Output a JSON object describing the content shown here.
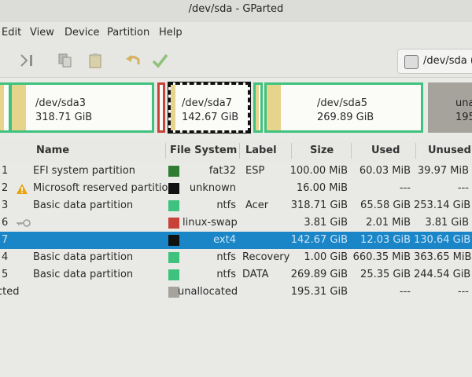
{
  "window": {
    "title": "/dev/sda - GParted"
  },
  "menu": [
    "Edit",
    "View",
    "Device",
    "Partition",
    "Help"
  ],
  "toolbar": {
    "icons": [
      "apply-icon",
      "copy-icon",
      "paste-icon",
      "undo-icon",
      "check-icon"
    ],
    "device": "/dev/sda ("
  },
  "map": {
    "blocks": [
      {
        "name": "/dev/sda3",
        "size": "318.71 GiB"
      },
      {
        "name": "/dev/sda7",
        "size": "142.67 GiB"
      },
      {
        "name": "/dev/sda5",
        "size": "269.89 GiB"
      },
      {
        "name": "una",
        "size": "195"
      }
    ]
  },
  "table": {
    "headers": [
      "Name",
      "File System",
      "Label",
      "Size",
      "Used",
      "Unused"
    ],
    "rows": [
      {
        "num": "1",
        "name": "EFI system partition",
        "fs": "fat32",
        "fs_color": "#2e7d32",
        "label": "ESP",
        "size": "100.00 MiB",
        "used": "60.03 MiB",
        "unused": "39.97 MiB",
        "warn": false,
        "key": false
      },
      {
        "num": "2",
        "name": "Microsoft reserved partition",
        "fs": "unknown",
        "fs_color": "#111111",
        "label": "",
        "size": "16.00 MiB",
        "used": "---",
        "unused": "---",
        "warn": true,
        "key": false
      },
      {
        "num": "3",
        "name": "Basic data partition",
        "fs": "ntfs",
        "fs_color": "#3fc27e",
        "label": "Acer",
        "size": "318.71 GiB",
        "used": "65.58 GiB",
        "unused": "253.14 GiB",
        "warn": false,
        "key": false
      },
      {
        "num": "6",
        "name": "",
        "fs": "linux-swap",
        "fs_color": "#c8423a",
        "label": "",
        "size": "3.81 GiB",
        "used": "2.01 MiB",
        "unused": "3.81 GiB",
        "warn": false,
        "key": true
      },
      {
        "num": "7",
        "name": "",
        "fs": "ext4",
        "fs_color": "#111111",
        "label": "",
        "size": "142.67 GiB",
        "used": "12.03 GiB",
        "unused": "130.64 GiB",
        "warn": false,
        "key": false,
        "selected": true
      },
      {
        "num": "4",
        "name": "Basic data partition",
        "fs": "ntfs",
        "fs_color": "#3fc27e",
        "label": "Recovery",
        "size": "1.00 GiB",
        "used": "660.35 MiB",
        "unused": "363.65 MiB",
        "warn": false,
        "key": false
      },
      {
        "num": "5",
        "name": "Basic data partition",
        "fs": "ntfs",
        "fs_color": "#3fc27e",
        "label": "DATA",
        "size": "269.89 GiB",
        "used": "25.35 GiB",
        "unused": "244.54 GiB",
        "warn": false,
        "key": false
      },
      {
        "num": "cted",
        "name": "",
        "fs": "unallocated",
        "fs_color": "#a6a39c",
        "label": "",
        "size": "195.31 GiB",
        "used": "---",
        "unused": "---",
        "warn": false,
        "key": false
      }
    ]
  },
  "colors": {
    "selection": "#1a86c8",
    "ntfs": "#3fc27e",
    "fat32": "#2e7d32",
    "swap": "#c8423a",
    "ext4": "#111111",
    "unallocated": "#a6a39c"
  }
}
